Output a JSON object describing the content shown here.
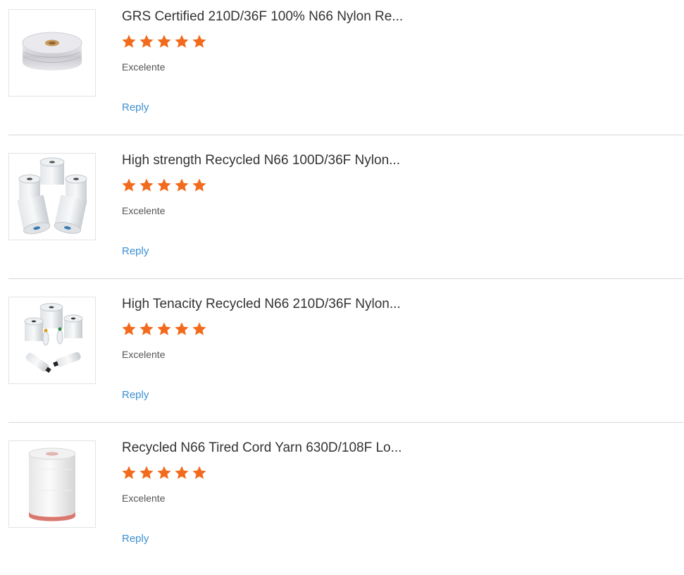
{
  "reviews": [
    {
      "title": "GRS Certified 210D/36F 100% N66 Nylon Re...",
      "rating": 5,
      "rating_label": "Excelente",
      "reply_label": "Reply",
      "thumbnail": "single-yarn-spool-icon"
    },
    {
      "title": "High strength Recycled N66 100D/36F Nylon...",
      "rating": 5,
      "rating_label": "Excelente",
      "reply_label": "Reply",
      "thumbnail": "stacked-yarn-spools-icon"
    },
    {
      "title": "High Tenacity Recycled N66 210D/36F Nylon...",
      "rating": 5,
      "rating_label": "Excelente",
      "reply_label": "Reply",
      "thumbnail": "yarn-cones-icon"
    },
    {
      "title": "Recycled N66 Tired Cord Yarn 630D/108F Lo...",
      "rating": 5,
      "rating_label": "Excelente",
      "reply_label": "Reply",
      "thumbnail": "cord-yarn-bobbin-icon"
    }
  ],
  "colors": {
    "star": "#f26a1b",
    "link": "#3c8fd1",
    "title": "#333333",
    "divider": "#d6d6d6"
  }
}
